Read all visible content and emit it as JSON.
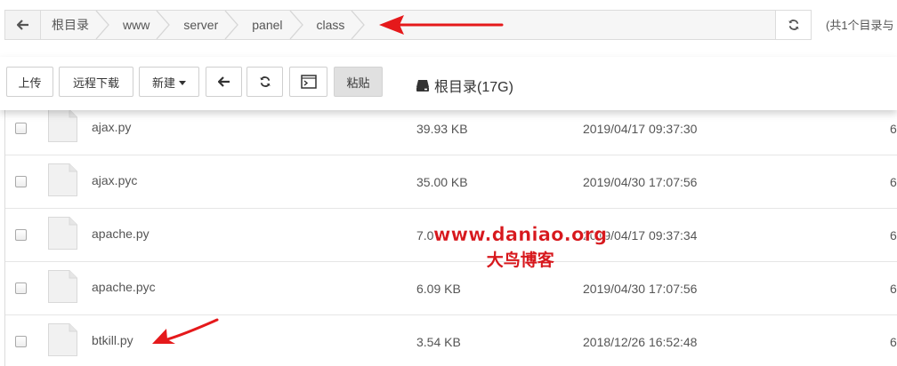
{
  "breadcrumb": {
    "items": [
      "根目录",
      "www",
      "server",
      "panel",
      "class"
    ],
    "count_text": "(共1个目录与"
  },
  "toolbar": {
    "upload_label": "上传",
    "remote_download_label": "远程下载",
    "new_label": "新建",
    "paste_label": "粘贴",
    "disk_label": "根目录(17G)"
  },
  "files": [
    {
      "name": "ajax.py",
      "size": "39.93 KB",
      "modified": "2019/04/17 09:37:30",
      "perm": "6"
    },
    {
      "name": "ajax.pyc",
      "size": "35.00 KB",
      "modified": "2019/04/30 17:07:56",
      "perm": "6"
    },
    {
      "name": "apache.py",
      "size": "7.0",
      "modified": "2019/04/17 09:37:34",
      "perm": "6"
    },
    {
      "name": "apache.pyc",
      "size": "6.09 KB",
      "modified": "2019/04/30 17:07:56",
      "perm": "6"
    },
    {
      "name": "btkill.py",
      "size": "3.54 KB",
      "modified": "2018/12/26 16:52:48",
      "perm": "6"
    }
  ],
  "watermark": {
    "url": "www.daniao.org",
    "name": "大鸟博客"
  },
  "colors": {
    "annotation_arrow": "#e5191b",
    "watermark": "#d7181d",
    "paste_button_bg": "#e0e0e0"
  },
  "icons": {
    "back": "arrow-left-icon",
    "refresh": "refresh-icon",
    "terminal": "terminal-icon",
    "disk": "hdd-icon",
    "file": "file-icon",
    "caret": "caret-down-icon"
  }
}
